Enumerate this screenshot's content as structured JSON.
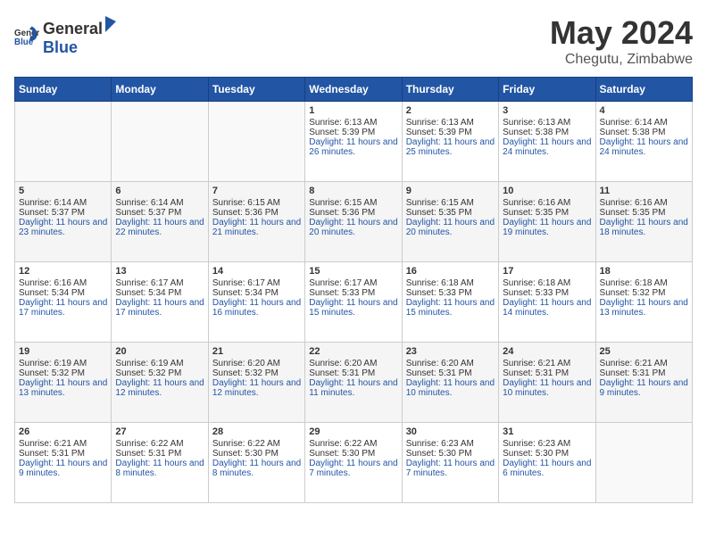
{
  "header": {
    "logo_general": "General",
    "logo_blue": "Blue",
    "month_title": "May 2024",
    "location": "Chegutu, Zimbabwe"
  },
  "days_of_week": [
    "Sunday",
    "Monday",
    "Tuesday",
    "Wednesday",
    "Thursday",
    "Friday",
    "Saturday"
  ],
  "weeks": [
    {
      "cells": [
        {
          "day": "",
          "content": ""
        },
        {
          "day": "",
          "content": ""
        },
        {
          "day": "",
          "content": ""
        },
        {
          "day": "1",
          "content": "Sunrise: 6:13 AM\nSunset: 5:39 PM\nDaylight: 11 hours and 26 minutes."
        },
        {
          "day": "2",
          "content": "Sunrise: 6:13 AM\nSunset: 5:39 PM\nDaylight: 11 hours and 25 minutes."
        },
        {
          "day": "3",
          "content": "Sunrise: 6:13 AM\nSunset: 5:38 PM\nDaylight: 11 hours and 24 minutes."
        },
        {
          "day": "4",
          "content": "Sunrise: 6:14 AM\nSunset: 5:38 PM\nDaylight: 11 hours and 24 minutes."
        }
      ]
    },
    {
      "cells": [
        {
          "day": "5",
          "content": "Sunrise: 6:14 AM\nSunset: 5:37 PM\nDaylight: 11 hours and 23 minutes."
        },
        {
          "day": "6",
          "content": "Sunrise: 6:14 AM\nSunset: 5:37 PM\nDaylight: 11 hours and 22 minutes."
        },
        {
          "day": "7",
          "content": "Sunrise: 6:15 AM\nSunset: 5:36 PM\nDaylight: 11 hours and 21 minutes."
        },
        {
          "day": "8",
          "content": "Sunrise: 6:15 AM\nSunset: 5:36 PM\nDaylight: 11 hours and 20 minutes."
        },
        {
          "day": "9",
          "content": "Sunrise: 6:15 AM\nSunset: 5:35 PM\nDaylight: 11 hours and 20 minutes."
        },
        {
          "day": "10",
          "content": "Sunrise: 6:16 AM\nSunset: 5:35 PM\nDaylight: 11 hours and 19 minutes."
        },
        {
          "day": "11",
          "content": "Sunrise: 6:16 AM\nSunset: 5:35 PM\nDaylight: 11 hours and 18 minutes."
        }
      ]
    },
    {
      "cells": [
        {
          "day": "12",
          "content": "Sunrise: 6:16 AM\nSunset: 5:34 PM\nDaylight: 11 hours and 17 minutes."
        },
        {
          "day": "13",
          "content": "Sunrise: 6:17 AM\nSunset: 5:34 PM\nDaylight: 11 hours and 17 minutes."
        },
        {
          "day": "14",
          "content": "Sunrise: 6:17 AM\nSunset: 5:34 PM\nDaylight: 11 hours and 16 minutes."
        },
        {
          "day": "15",
          "content": "Sunrise: 6:17 AM\nSunset: 5:33 PM\nDaylight: 11 hours and 15 minutes."
        },
        {
          "day": "16",
          "content": "Sunrise: 6:18 AM\nSunset: 5:33 PM\nDaylight: 11 hours and 15 minutes."
        },
        {
          "day": "17",
          "content": "Sunrise: 6:18 AM\nSunset: 5:33 PM\nDaylight: 11 hours and 14 minutes."
        },
        {
          "day": "18",
          "content": "Sunrise: 6:18 AM\nSunset: 5:32 PM\nDaylight: 11 hours and 13 minutes."
        }
      ]
    },
    {
      "cells": [
        {
          "day": "19",
          "content": "Sunrise: 6:19 AM\nSunset: 5:32 PM\nDaylight: 11 hours and 13 minutes."
        },
        {
          "day": "20",
          "content": "Sunrise: 6:19 AM\nSunset: 5:32 PM\nDaylight: 11 hours and 12 minutes."
        },
        {
          "day": "21",
          "content": "Sunrise: 6:20 AM\nSunset: 5:32 PM\nDaylight: 11 hours and 12 minutes."
        },
        {
          "day": "22",
          "content": "Sunrise: 6:20 AM\nSunset: 5:31 PM\nDaylight: 11 hours and 11 minutes."
        },
        {
          "day": "23",
          "content": "Sunrise: 6:20 AM\nSunset: 5:31 PM\nDaylight: 11 hours and 10 minutes."
        },
        {
          "day": "24",
          "content": "Sunrise: 6:21 AM\nSunset: 5:31 PM\nDaylight: 11 hours and 10 minutes."
        },
        {
          "day": "25",
          "content": "Sunrise: 6:21 AM\nSunset: 5:31 PM\nDaylight: 11 hours and 9 minutes."
        }
      ]
    },
    {
      "cells": [
        {
          "day": "26",
          "content": "Sunrise: 6:21 AM\nSunset: 5:31 PM\nDaylight: 11 hours and 9 minutes."
        },
        {
          "day": "27",
          "content": "Sunrise: 6:22 AM\nSunset: 5:31 PM\nDaylight: 11 hours and 8 minutes."
        },
        {
          "day": "28",
          "content": "Sunrise: 6:22 AM\nSunset: 5:30 PM\nDaylight: 11 hours and 8 minutes."
        },
        {
          "day": "29",
          "content": "Sunrise: 6:22 AM\nSunset: 5:30 PM\nDaylight: 11 hours and 7 minutes."
        },
        {
          "day": "30",
          "content": "Sunrise: 6:23 AM\nSunset: 5:30 PM\nDaylight: 11 hours and 7 minutes."
        },
        {
          "day": "31",
          "content": "Sunrise: 6:23 AM\nSunset: 5:30 PM\nDaylight: 11 hours and 6 minutes."
        },
        {
          "day": "",
          "content": ""
        }
      ]
    }
  ]
}
